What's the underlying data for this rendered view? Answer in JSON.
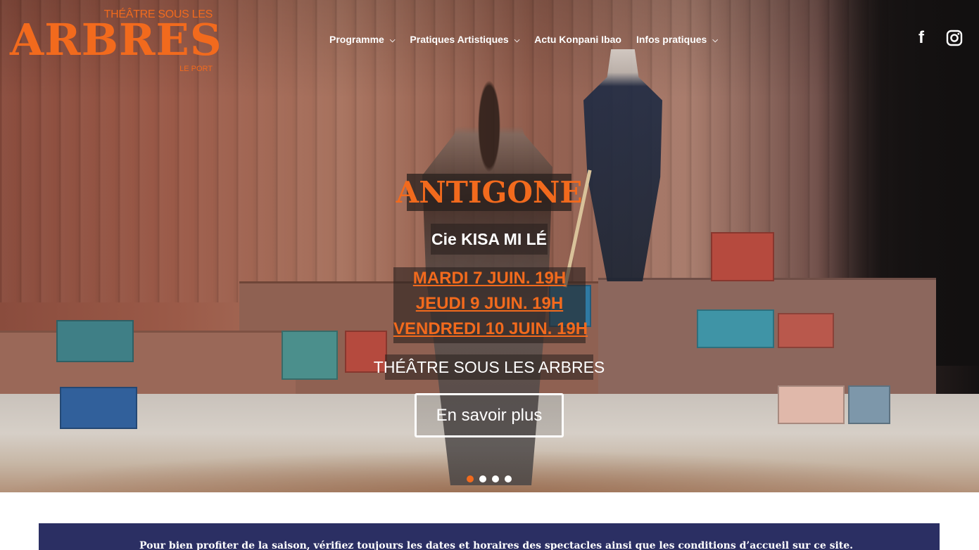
{
  "logo": {
    "top": "THÉÂTRE SOUS LES",
    "main": "ARBRES",
    "bottom": "LE PORT"
  },
  "nav": {
    "items": [
      {
        "label": "Programme",
        "has_dropdown": true
      },
      {
        "label": "Pratiques Artistiques",
        "has_dropdown": true
      },
      {
        "label": "Actu Konpani Ibao",
        "has_dropdown": false
      },
      {
        "label": "Infos pratiques",
        "has_dropdown": true
      }
    ]
  },
  "social": {
    "facebook_icon": "facebook-icon",
    "instagram_icon": "instagram-icon"
  },
  "slide": {
    "title": "ANTIGONE",
    "company": "Cie KISA MI LÉ",
    "dates": [
      "MARDI 7 JUIN. 19H",
      "JEUDI 9 JUIN. 19H",
      "VENDREDI 10 JUIN. 19H"
    ],
    "venue": "THÉÂTRE SOUS LES ARBRES",
    "cta": "En savoir plus"
  },
  "slider": {
    "count": 4,
    "active_index": 0
  },
  "notice": {
    "text": "Pour bien profiter de la saison, vérifiez toujours les dates et horaires des spectacles ainsi que les conditions d’accueil sur ce site."
  },
  "colors": {
    "accent": "#f26a1d",
    "notice_bg": "#2b2f63"
  }
}
